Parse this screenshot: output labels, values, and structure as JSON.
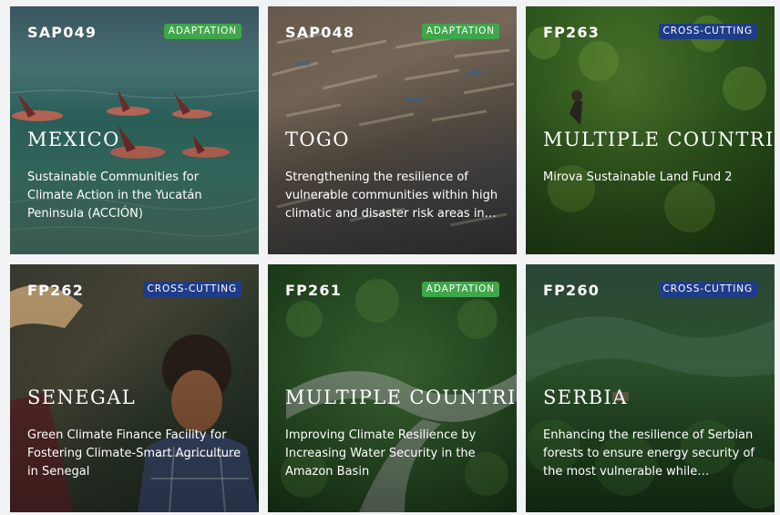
{
  "cards": [
    {
      "code": "SAP049",
      "badge": "ADAPTATION",
      "country": "MEXICO",
      "description": "Sustainable Communities for Climate Action in the Yucatán Peninsula (ACCIÓN)"
    },
    {
      "code": "SAP048",
      "badge": "ADAPTATION",
      "country": "TOGO",
      "description": "Strengthening the resilience of vulnerable communities within high climatic and disaster risk areas in T..."
    },
    {
      "code": "FP263",
      "badge": "CROSS-CUTTING",
      "country": "MULTIPLE COUNTRIES",
      "description": "Mirova Sustainable Land Fund 2"
    },
    {
      "code": "FP262",
      "badge": "CROSS-CUTTING",
      "country": "SENEGAL",
      "description": "Green Climate Finance Facility for Fostering Climate-Smart Agriculture in Senegal"
    },
    {
      "code": "FP261",
      "badge": "ADAPTATION",
      "country": "MULTIPLE COUNTRIES",
      "description": "Improving Climate Resilience by Increasing Water Security in the Amazon Basin"
    },
    {
      "code": "FP260",
      "badge": "CROSS-CUTTING",
      "country": "SERBIA",
      "description": "Enhancing the resilience of Serbian forests to ensure energy security of the most vulnerable while contribu..."
    }
  ],
  "colors": {
    "adaptation": "#3fa64a",
    "cross_cutting": "#1f3c88"
  }
}
